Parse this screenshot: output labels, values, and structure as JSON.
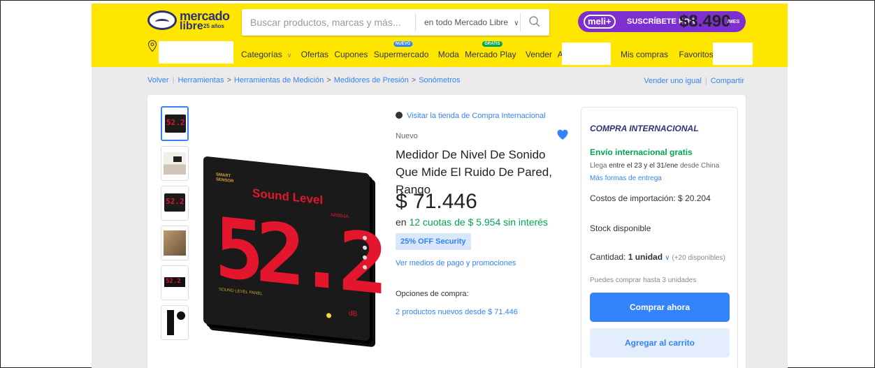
{
  "header": {
    "logo": {
      "word1": "mercado",
      "word2": "libre",
      "years": "25 años"
    },
    "search": {
      "placeholder": "Buscar productos, marcas y más...",
      "scope": "en todo Mercado Libre"
    },
    "meli_plus": {
      "badge": "meli+",
      "cta": "SUSCRÍBETE POR",
      "price": "$8.490",
      "period": "/MES"
    },
    "nav": {
      "items": [
        {
          "label": "Categorías",
          "tag": ""
        },
        {
          "label": "Ofertas",
          "tag": ""
        },
        {
          "label": "Cupones",
          "tag": ""
        },
        {
          "label": "Supermercado",
          "tag": "NUEVO"
        },
        {
          "label": "Moda",
          "tag": ""
        },
        {
          "label": "Mercado Play",
          "tag": "GRATIS"
        },
        {
          "label": "Vender",
          "tag": ""
        },
        {
          "label": "Ayuda",
          "tag": ""
        }
      ],
      "my_purchases": "Mis compras",
      "favorites": "Favoritos"
    }
  },
  "breadcrumb": {
    "back": "Volver",
    "items": [
      "Herramientas",
      "Herramientas de Medición",
      "Medidores de Presión",
      "Sonómetros"
    ],
    "sell_same": "Vender uno igual",
    "share": "Compartir"
  },
  "product": {
    "store_link": "Visitar la tienda de Compra Internacional",
    "condition": "Nuevo",
    "title": "Medidor De Nivel De Sonido Que Mide El Ruido De Pared, Rango",
    "price": "$ 71.446",
    "installments_prefix": "en",
    "installments": "12 cuotas de $ 5.954 sin interés",
    "discount_badge": "25% OFF Security",
    "payment_link": "Ver medios de pago y promociones",
    "purchase_options_label": "Opciones de compra:",
    "purchase_options_link": "2 productos nuevos desde $ 71.446",
    "device": {
      "brand_top": "SMART",
      "brand_bottom": "SENSOR",
      "title": "Sound Level",
      "model": "AR884A",
      "reading": "52.2",
      "panel": "SOUND LEVEL PANEL",
      "unit": "dB"
    }
  },
  "buybox": {
    "heading": "COMPRA INTERNACIONAL",
    "shipping": "Envío internacional gratis",
    "arrival_pre": "Llega",
    "arrival_dates": "entre el 23 y el 31/ene",
    "arrival_post": "desde China",
    "more_delivery": "Más formas de entrega",
    "import_costs": "Costos de importación: $ 20.204",
    "stock": "Stock disponible",
    "qty_label": "Cantidad:",
    "qty_value": "1 unidad",
    "qty_available": "(+20 disponibles)",
    "limit": "Puedes comprar hasta 3 unidades",
    "buy_now": "Comprar ahora",
    "add_cart": "Agregar al carrito"
  },
  "colors": {
    "header_yellow": "#ffe600",
    "accent_blue": "#3483fa",
    "green": "#00a650",
    "meli_purple": "#7d2fd0",
    "display_red": "#e3162e"
  }
}
